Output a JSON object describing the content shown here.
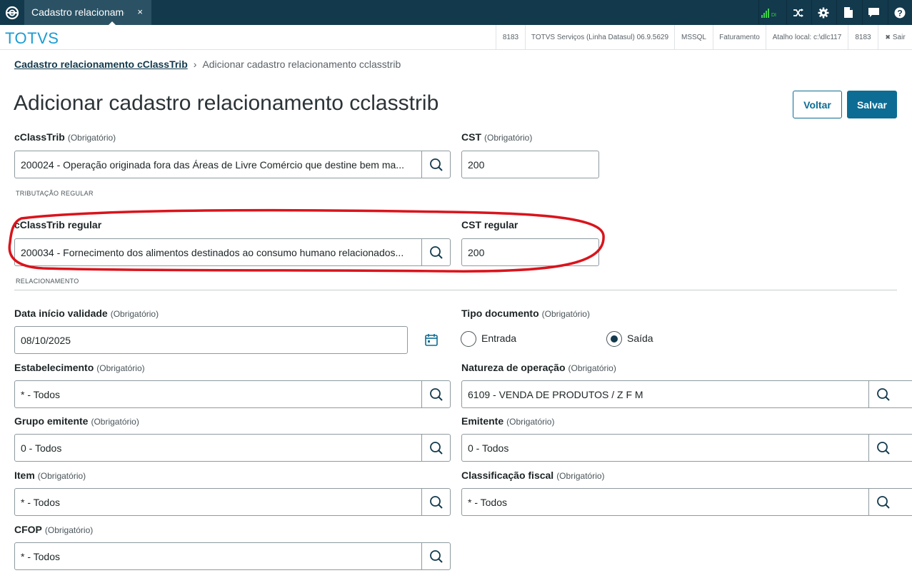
{
  "window": {
    "tab_label": "Cadastro relacionamento",
    "tab_close": "×"
  },
  "subbar": {
    "brand": "TOTVS",
    "info": [
      "8183",
      "TOTVS Serviços (Linha Datasul) 06.9.5629",
      "MSSQL",
      "Faturamento",
      "Atalho local: c:\\dlc117",
      "8183"
    ],
    "exit_label": "Sair",
    "exit_icon": "✖"
  },
  "toolbar_icons": [
    "signal-icon",
    "shuffle-icon",
    "gear-icon",
    "document-icon",
    "chat-icon",
    "help-icon"
  ],
  "signal_text": "DI",
  "breadcrumb": {
    "link": "Cadastro relacionamento cClassTrib",
    "separator": "›",
    "current": "Adicionar cadastro relacionamento cclasstrib"
  },
  "page_title": "Adicionar cadastro relacionamento cclasstrib",
  "buttons": {
    "voltar": "Voltar",
    "salvar": "Salvar"
  },
  "required": "(Obrigatório)",
  "fields": {
    "cclasstrib": {
      "label": "cClassTrib",
      "value": "200024 - Operação originada fora das Áreas de Livre Comércio que destine bem ma..."
    },
    "cst": {
      "label": "CST",
      "value": "200"
    },
    "section_tributacao": "TRIBUTAÇÃO REGULAR",
    "cclasstrib_regular": {
      "label": "cClassTrib regular",
      "value": "200034 - Fornecimento dos alimentos destinados ao consumo humano relacionados..."
    },
    "cst_regular": {
      "label": "CST regular",
      "value": "200"
    },
    "section_relacionamento": "RELACIONAMENTO",
    "data_inicio": {
      "label": "Data início validade",
      "value": "08/10/2025"
    },
    "tipo_documento": {
      "label": "Tipo documento",
      "options": [
        "Entrada",
        "Saída"
      ],
      "selected": "Saída"
    },
    "estabelecimento": {
      "label": "Estabelecimento",
      "value": "* - Todos"
    },
    "natureza": {
      "label": "Natureza de operação",
      "value": "6109 - VENDA DE PRODUTOS / Z F M"
    },
    "grupo_emitente": {
      "label": "Grupo emitente",
      "value": "0 - Todos"
    },
    "emitente": {
      "label": "Emitente",
      "value": "0 - Todos"
    },
    "item": {
      "label": "Item",
      "value": "* - Todos"
    },
    "classificacao": {
      "label": "Classificação fiscal",
      "value": "* - Todos"
    },
    "cfop": {
      "label": "CFOP",
      "value": "* - Todos"
    }
  },
  "colors": {
    "topbar": "#12394c",
    "primary": "#0c6c94",
    "brand": "#1b9cd3",
    "annotation": "#d9141c"
  }
}
